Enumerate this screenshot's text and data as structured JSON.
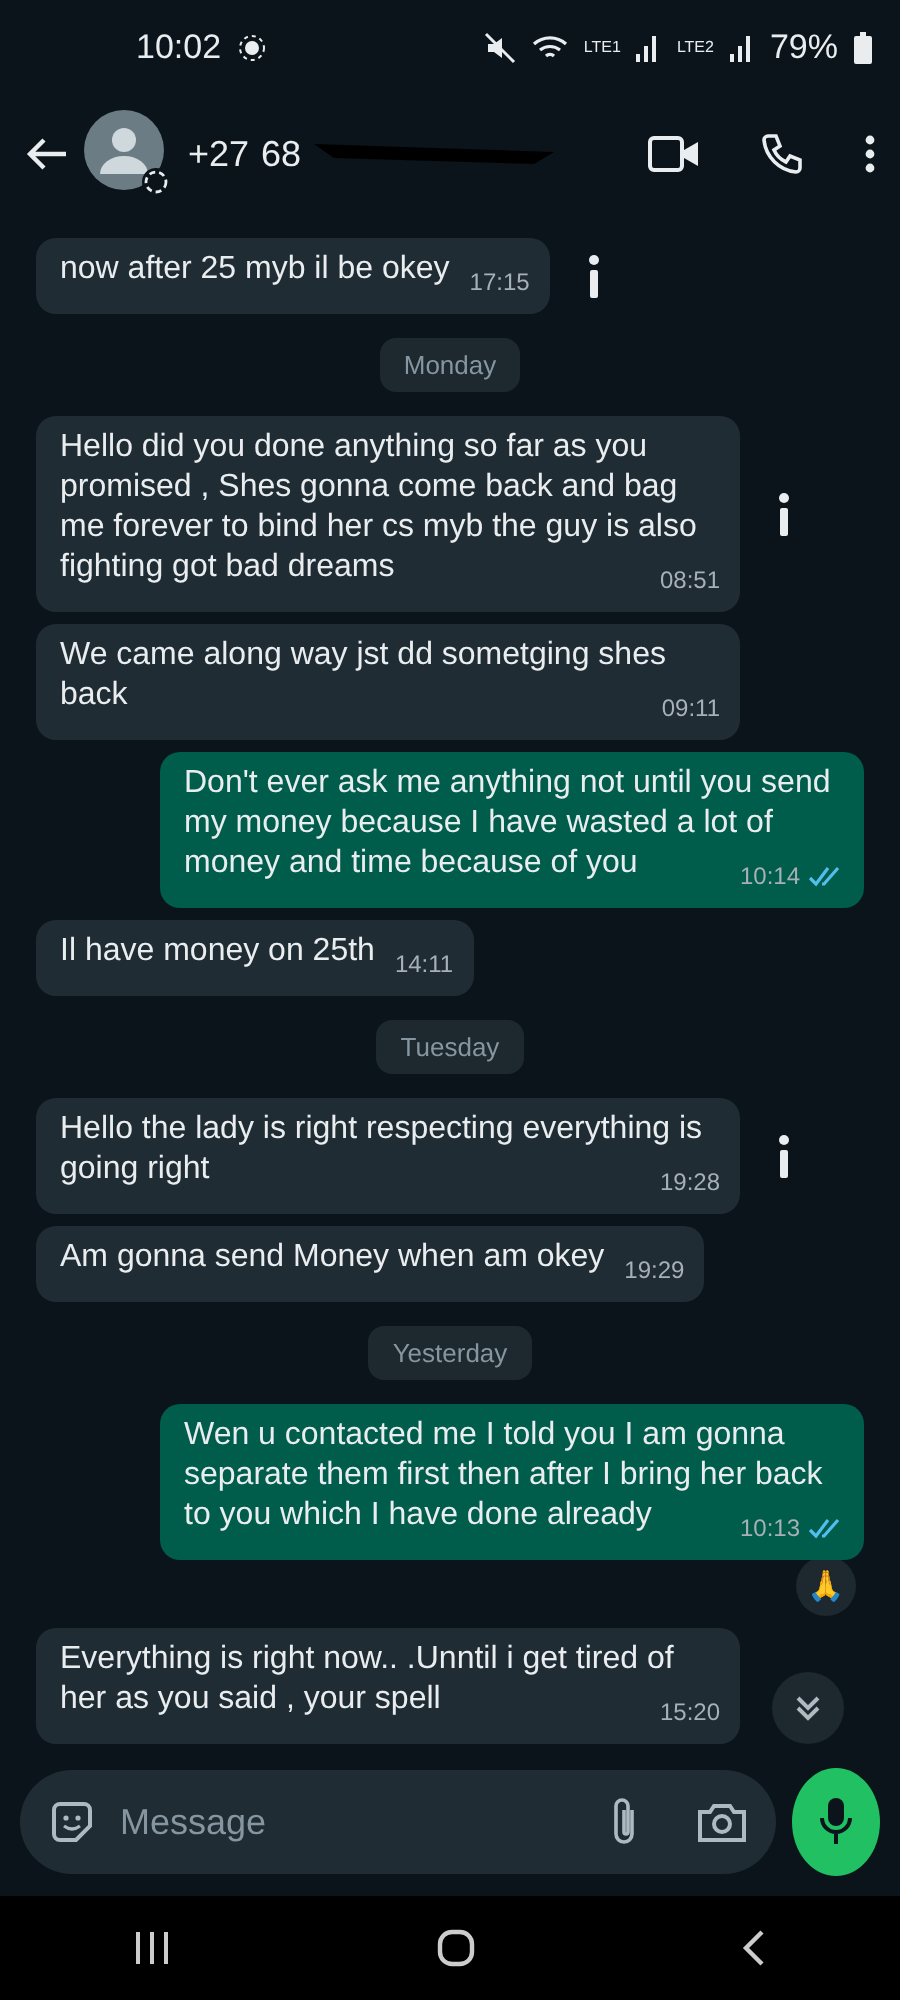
{
  "status_bar": {
    "time": "10:02",
    "sim1": "LTE1",
    "sim2": "LTE2",
    "battery": "79%"
  },
  "header": {
    "contact": "+27",
    "contact_partial": "68"
  },
  "messages": [
    {
      "kind": "in",
      "text": "now after 25 myb il be okey",
      "time": "17:15",
      "flagged": true
    },
    {
      "kind": "date",
      "text": "Monday"
    },
    {
      "kind": "in",
      "text": "Hello did you done anything so far as you promised , Shes gonna come back and bag me forever to bind her cs myb the guy is also fighting got bad dreams",
      "time": "08:51",
      "flagged": true
    },
    {
      "kind": "in",
      "text": "We came along way jst  dd sometging shes back",
      "time": "09:11",
      "flagged": false
    },
    {
      "kind": "out",
      "text": "Don't ever ask me anything not until you send my money because I have wasted a lot of money and time because of you",
      "time": "10:14",
      "read": true
    },
    {
      "kind": "in",
      "text": "Il have money on 25th",
      "time": "14:11",
      "flagged": false
    },
    {
      "kind": "date",
      "text": "Tuesday"
    },
    {
      "kind": "in",
      "text": "Hello the lady is right respecting everything is going right",
      "time": "19:28",
      "flagged": true
    },
    {
      "kind": "in",
      "text": "Am gonna send Money when am okey",
      "time": "19:29",
      "flagged": false
    },
    {
      "kind": "date",
      "text": "Yesterday"
    },
    {
      "kind": "out",
      "text": "Wen u contacted me I told you I am gonna separate them first then after I bring her back to you which I have done already",
      "time": "10:13",
      "read": true,
      "reaction": "🙏"
    },
    {
      "kind": "in",
      "text": "Everything is right now.. .Unntil i get tired of her as you said , your spell",
      "time": "15:20",
      "flagged": false
    }
  ],
  "composer": {
    "placeholder": "Message"
  }
}
